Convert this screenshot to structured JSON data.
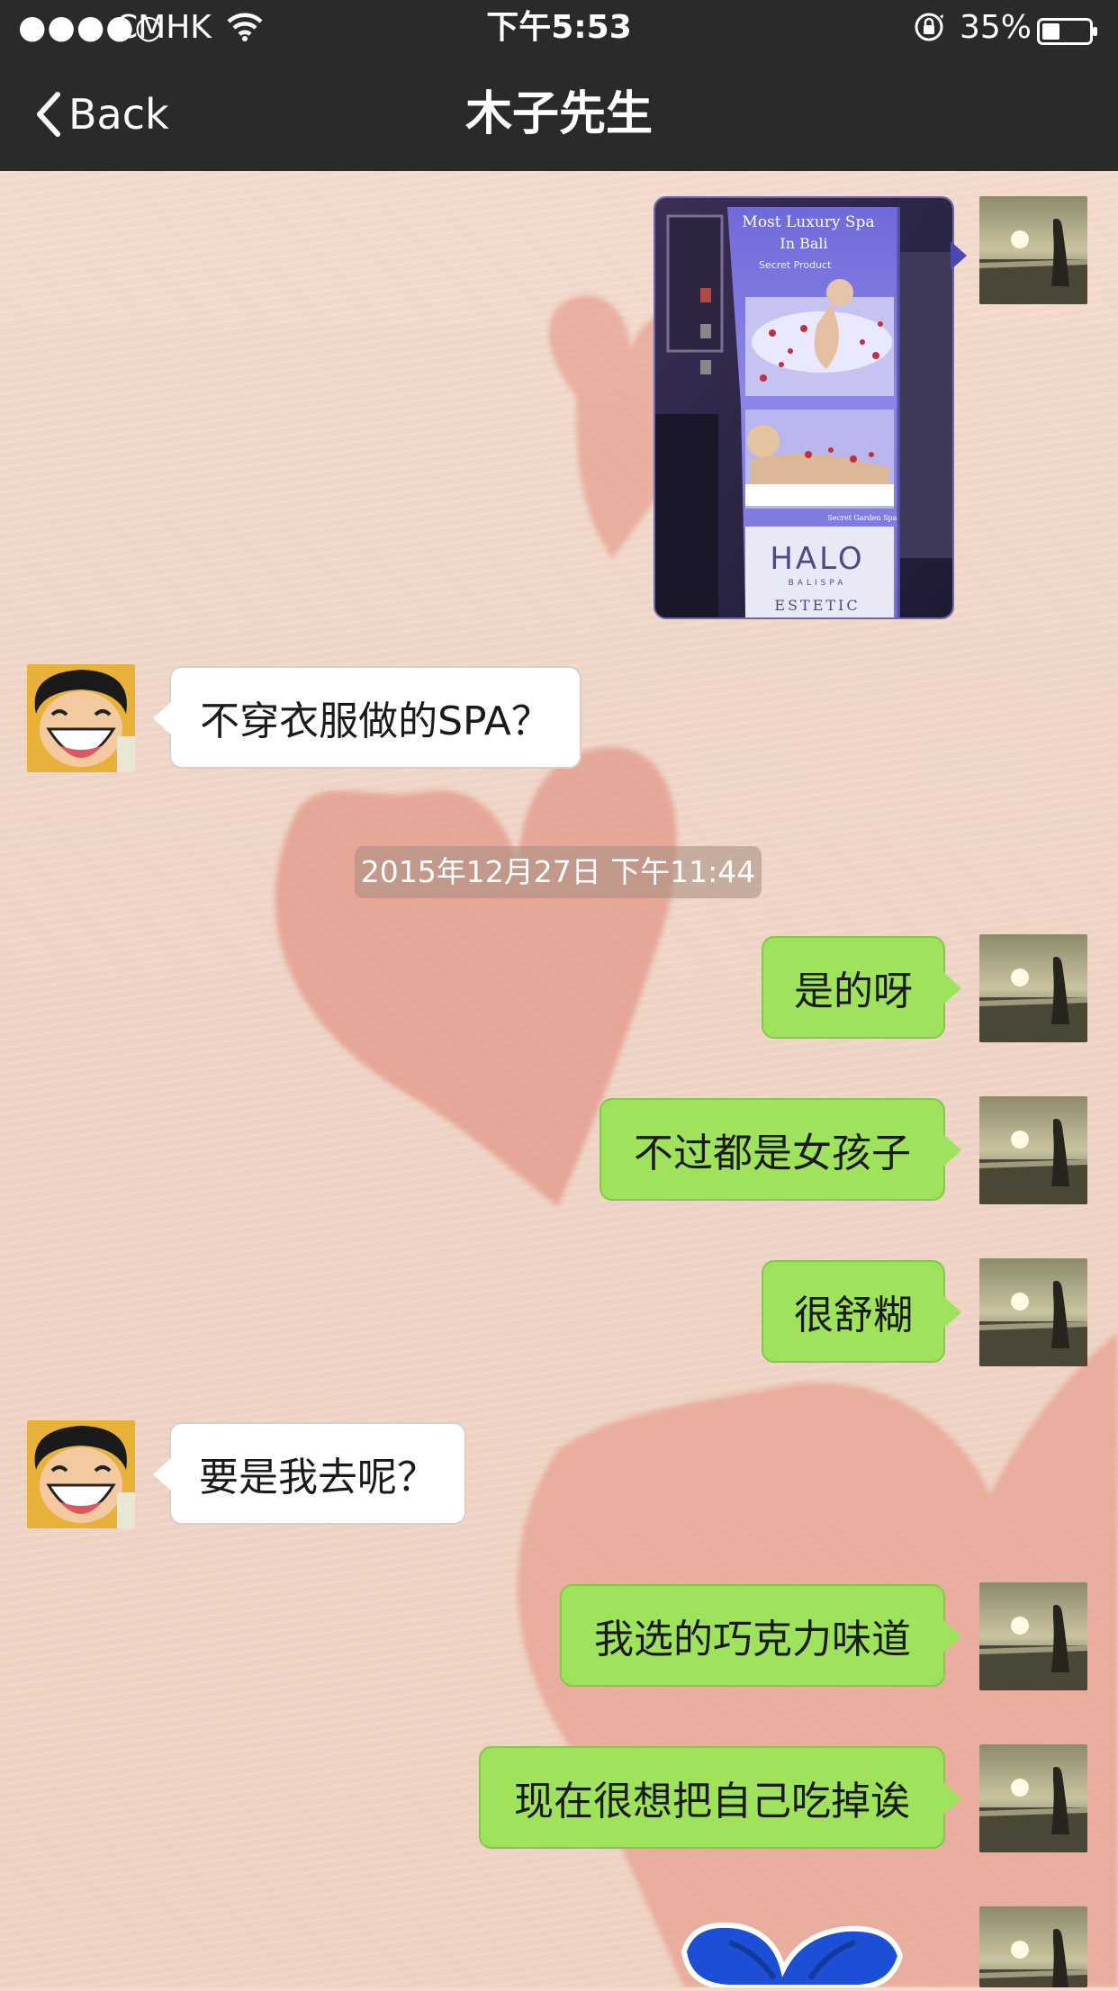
{
  "status_bar": {
    "signal": "●●●●○",
    "carrier": "CMHK",
    "time": "下午5:53",
    "battery": "35%"
  },
  "nav": {
    "back_label": "Back",
    "title": "木子先生"
  },
  "image_message": {
    "poster_line1": "Most Luxury Spa",
    "poster_line2": "In Bali",
    "poster_line3": "Secret Product",
    "poster_small": "Secret Garden Spa",
    "brand": "HALO",
    "brand_sub": "BALISPA",
    "brand_bottom": "ESTETIC"
  },
  "messages": [
    {
      "side": "in",
      "text": "不穿衣服做的SPA？"
    },
    {
      "side": "out",
      "text": "是的呀"
    },
    {
      "side": "out",
      "text": "不过都是女孩子"
    },
    {
      "side": "out",
      "text": "很舒糊"
    },
    {
      "side": "in",
      "text": "要是我去呢？"
    },
    {
      "side": "out",
      "text": "我选的巧克力味道"
    },
    {
      "side": "out",
      "text": "现在很想把自己吃掉诶"
    }
  ],
  "timestamp": "2015年12月27日 下午11:44",
  "colors": {
    "nav_bg": "#2b2a29",
    "outgoing_bubble": "#9ee35b",
    "incoming_bubble": "#ffffff",
    "background": "#f2d9cc",
    "heart": "#e08a78"
  },
  "icons": [
    "chevron-left-icon",
    "wifi-icon",
    "orientation-lock-icon",
    "battery-icon"
  ]
}
